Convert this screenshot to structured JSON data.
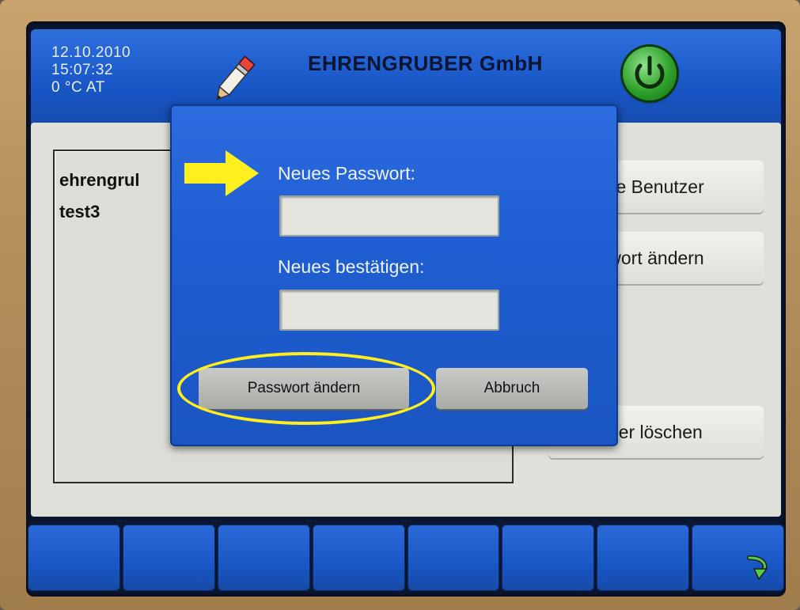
{
  "header": {
    "date": "12.10.2010",
    "time": "15:07:32",
    "temperature": "0 °C AT",
    "company": "EHRENGRUBER GmbH"
  },
  "user_list": {
    "items": [
      "ehrengrul",
      "test3"
    ]
  },
  "side_buttons": {
    "alle_benutzer": "lle Benutzer",
    "passwort_aendern": "wort ändern",
    "benutzer_loeschen": "zer löschen"
  },
  "dialog": {
    "new_password_label": "Neues Passwort:",
    "new_password_value": "",
    "confirm_label": "Neues bestätigen:",
    "confirm_value": "",
    "confirm_button": "Passwort ändern",
    "cancel_button": "Abbruch"
  },
  "icons": {
    "edit": "pencil-icon",
    "power": "power-icon",
    "return": "return-arrow-icon"
  },
  "colors": {
    "header_blue": "#1957c8",
    "dialog_blue": "#1f5ed2",
    "annotation_yellow": "#ffef1f",
    "power_green": "#2fa12b"
  }
}
